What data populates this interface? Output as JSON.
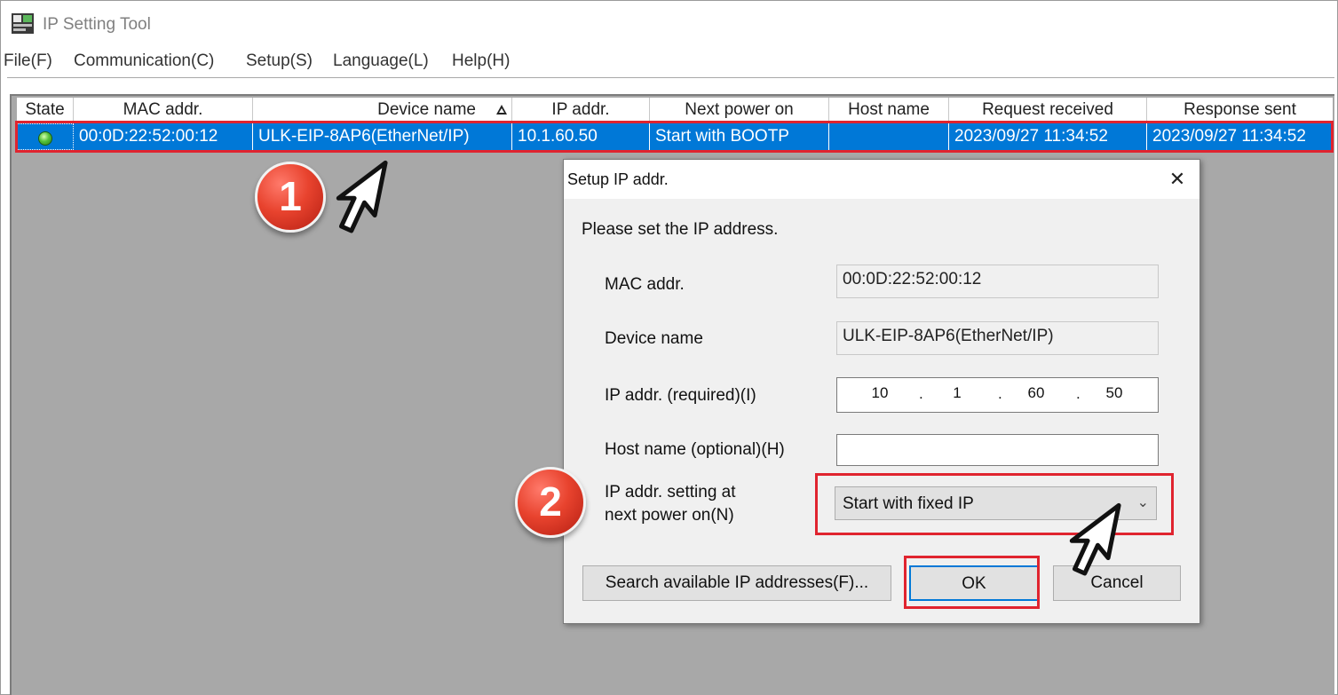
{
  "app": {
    "title": "IP Setting Tool"
  },
  "menu": [
    {
      "label": "File(F)"
    },
    {
      "label": "Communication(C)"
    },
    {
      "label": "Setup(S)"
    },
    {
      "label": "Language(L)"
    },
    {
      "label": "Help(H)"
    }
  ],
  "table": {
    "columns": [
      "State",
      "MAC addr.",
      "Device name",
      "IP addr.",
      "Next power on",
      "Host name",
      "Request received",
      "Response sent"
    ],
    "sorted_column": "Device name",
    "rows": [
      {
        "state": "connected",
        "mac": "00:0D:22:52:00:12",
        "device_name": "ULK-EIP-8AP6(EtherNet/IP)",
        "ip": "10.1.60.50",
        "next_power_on": "Start with BOOTP",
        "host_name": "",
        "request_received": "2023/09/27 11:34:52",
        "response_sent": "2023/09/27 11:34:52",
        "selected": true
      }
    ]
  },
  "dialog": {
    "title": "Setup IP addr.",
    "close_label": "✕",
    "instruction": "Please set the IP address.",
    "mac_label": "MAC addr.",
    "mac_value": "00:0D:22:52:00:12",
    "device_label": "Device name",
    "device_value": "ULK-EIP-8AP6(EtherNet/IP)",
    "ip_label": "IP addr. (required)(I)",
    "ip_octets": [
      "10",
      "1",
      "60",
      "50"
    ],
    "ip_separator": ".",
    "host_label": "Host name (optional)(H)",
    "host_value": "",
    "next_power_label_line1": "IP addr. setting at",
    "next_power_label_line2": "next power on(N)",
    "next_power_value": "Start with fixed IP",
    "search_button": "Search available IP addresses(F)...",
    "ok_button": "OK",
    "cancel_button": "Cancel"
  },
  "annotations": {
    "step1": "1",
    "step2": "2",
    "highlight_color": "#e0242f"
  },
  "colors": {
    "selection": "#0078d7",
    "list_background": "#a8a8a8",
    "dialog_background": "#f0f0f0"
  }
}
